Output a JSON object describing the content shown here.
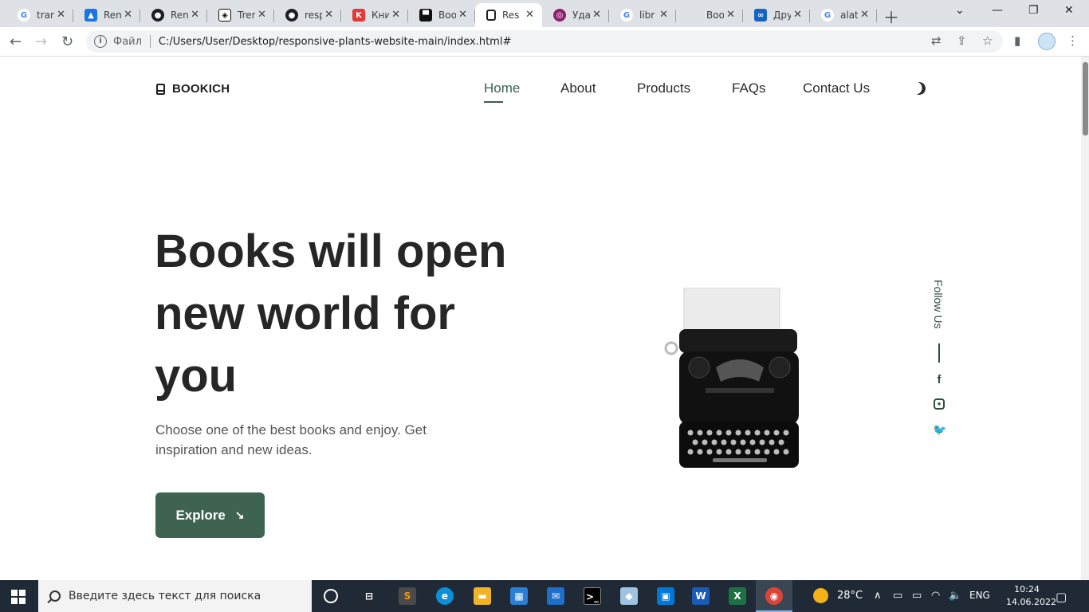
{
  "browser": {
    "tabs": [
      {
        "title": "tran",
        "favicon": "google-icon",
        "color": "#ffffff"
      },
      {
        "title": "Ren",
        "favicon": "doc-icon",
        "color": "#1a73e8"
      },
      {
        "title": "Ren",
        "favicon": "github-icon",
        "color": "#1b1f23"
      },
      {
        "title": "Trer",
        "favicon": "codepen-icon",
        "color": "#1b1f23"
      },
      {
        "title": "resp",
        "favicon": "github-icon",
        "color": "#1b1f23"
      },
      {
        "title": "Кни",
        "favicon": "book-red-icon",
        "color": "#e53935"
      },
      {
        "title": "Boo",
        "favicon": "unsplash-icon",
        "color": "#111111"
      },
      {
        "title": "Resp",
        "favicon": "book-icon",
        "color": "#202124"
      },
      {
        "title": "Уда",
        "favicon": "purple-icon",
        "color": "#8e1d6b"
      },
      {
        "title": "libr",
        "favicon": "google-icon",
        "color": "#ffffff"
      },
      {
        "title": "Boo",
        "favicon": "blank-icon",
        "color": "#dee1e6"
      },
      {
        "title": "Дру",
        "favicon": "loop-icon",
        "color": "#1565c0"
      },
      {
        "title": "alat",
        "favicon": "google-icon",
        "color": "#ffffff"
      }
    ],
    "address": {
      "scheme_label": "Файл",
      "url": "C:/Users/User/Desktop/responsive-plants-website-main/index.html#"
    }
  },
  "site": {
    "logo": "BOOKICH",
    "nav": [
      "Home",
      "About",
      "Products",
      "FAQs",
      "Contact Us"
    ],
    "active_nav": "Home",
    "hero": {
      "title_lines": [
        "Books will open",
        "new world for",
        "you"
      ],
      "description": "Choose one of the best books and enjoy. Get inspiration and new ideas.",
      "button": "Explore",
      "button_arrow": "↘"
    },
    "follow": {
      "label": "Follow Us",
      "icons": [
        "facebook-icon",
        "instagram-icon",
        "twitter-icon"
      ]
    },
    "accent_color": "#3e6351"
  },
  "taskbar": {
    "search_placeholder": "Введите здесь текст для поиска",
    "weather": "28°C",
    "language": "ENG",
    "time": "10:24",
    "date": "14.06.2022"
  }
}
